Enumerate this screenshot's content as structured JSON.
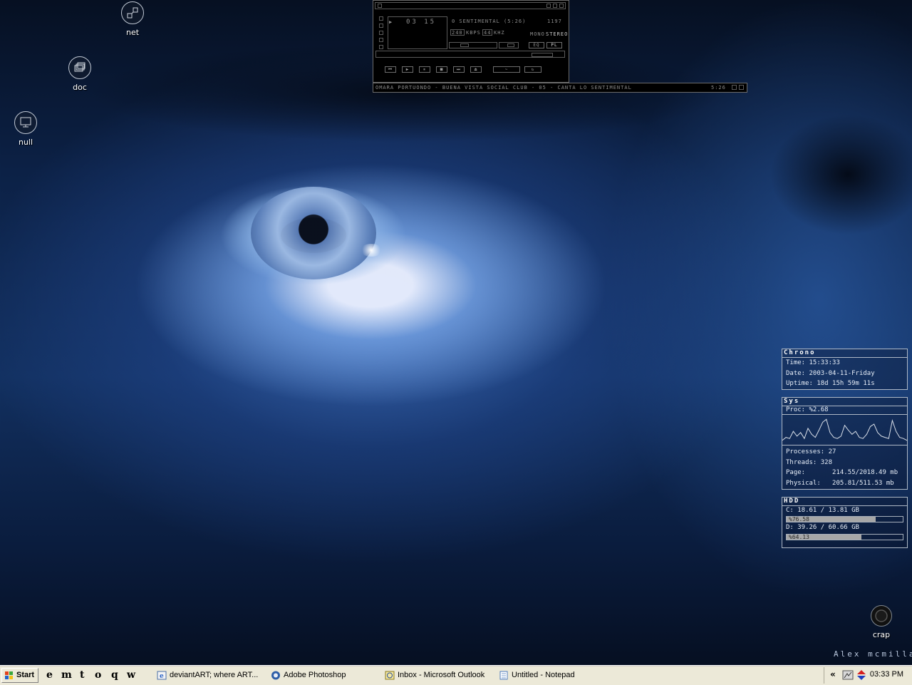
{
  "desktop": {
    "icons": [
      {
        "label": "net",
        "icon": "network-icon"
      },
      {
        "label": "doc",
        "icon": "documents-icon"
      },
      {
        "label": "null",
        "icon": "computer-icon"
      },
      {
        "label": "crap",
        "icon": "recycle-bin-icon"
      }
    ],
    "signature": "Alex mcmillan"
  },
  "winamp": {
    "track_title": "0 SENTIMENTAL (5:26)",
    "counter": "03 15",
    "track_num": "1197",
    "kbps": "240",
    "kbps_label": "KBPS",
    "khz": "44",
    "khz_label": "KHZ",
    "mono_label": "MONO",
    "stereo_label": "STEREO",
    "eq_label": "EQ",
    "pl_label": "PL",
    "playlist_entry": "OMARA PORTUONDO - BUENA VISTA SOCIAL CLUB - 05 - CANTA LO SENTIMENTAL",
    "playlist_time": "5:26"
  },
  "chrono": {
    "title": "Chrono",
    "time": "Time: 15:33:33",
    "date": "Date: 2003-04-11-Friday",
    "uptime": "Uptime: 18d 15h 59m 11s"
  },
  "sys": {
    "title": "Sys",
    "proc": "Proc: %2.68",
    "cpu_history": [
      5,
      10,
      8,
      20,
      12,
      18,
      8,
      25,
      15,
      10,
      22,
      35,
      40,
      18,
      10,
      8,
      12,
      30,
      22,
      15,
      20,
      10,
      8,
      15,
      28,
      32,
      18,
      12,
      10,
      8,
      38,
      20,
      10,
      8,
      5
    ],
    "processes": "Processes: 27",
    "threads": "Threads: 328",
    "page": "Page:       214.55/2018.49 mb",
    "physical": "Physical:   205.81/511.53 mb"
  },
  "hdd": {
    "title": "HDD",
    "c_line": "C: 18.61 / 13.81 GB",
    "c_pct_label": "%76.58",
    "c_pct": 76.58,
    "d_line": "D: 39.26 / 60.66 GB",
    "d_pct_label": "%64.13",
    "d_pct": 64.13
  },
  "taskbar": {
    "start_label": "Start",
    "quicklaunch": [
      "e",
      "m",
      "t",
      "o",
      "q",
      "w"
    ],
    "tasks": [
      {
        "label": "deviantART; where ART...",
        "icon": "internet-explorer-icon"
      },
      {
        "label": "Adobe Photoshop",
        "icon": "photoshop-icon"
      },
      {
        "label": "Inbox - Microsoft Outlook",
        "icon": "outlook-icon"
      },
      {
        "label": "Untitled - Notepad",
        "icon": "notepad-icon"
      }
    ],
    "tray_chevron": "«",
    "clock": "03:33 PM"
  }
}
